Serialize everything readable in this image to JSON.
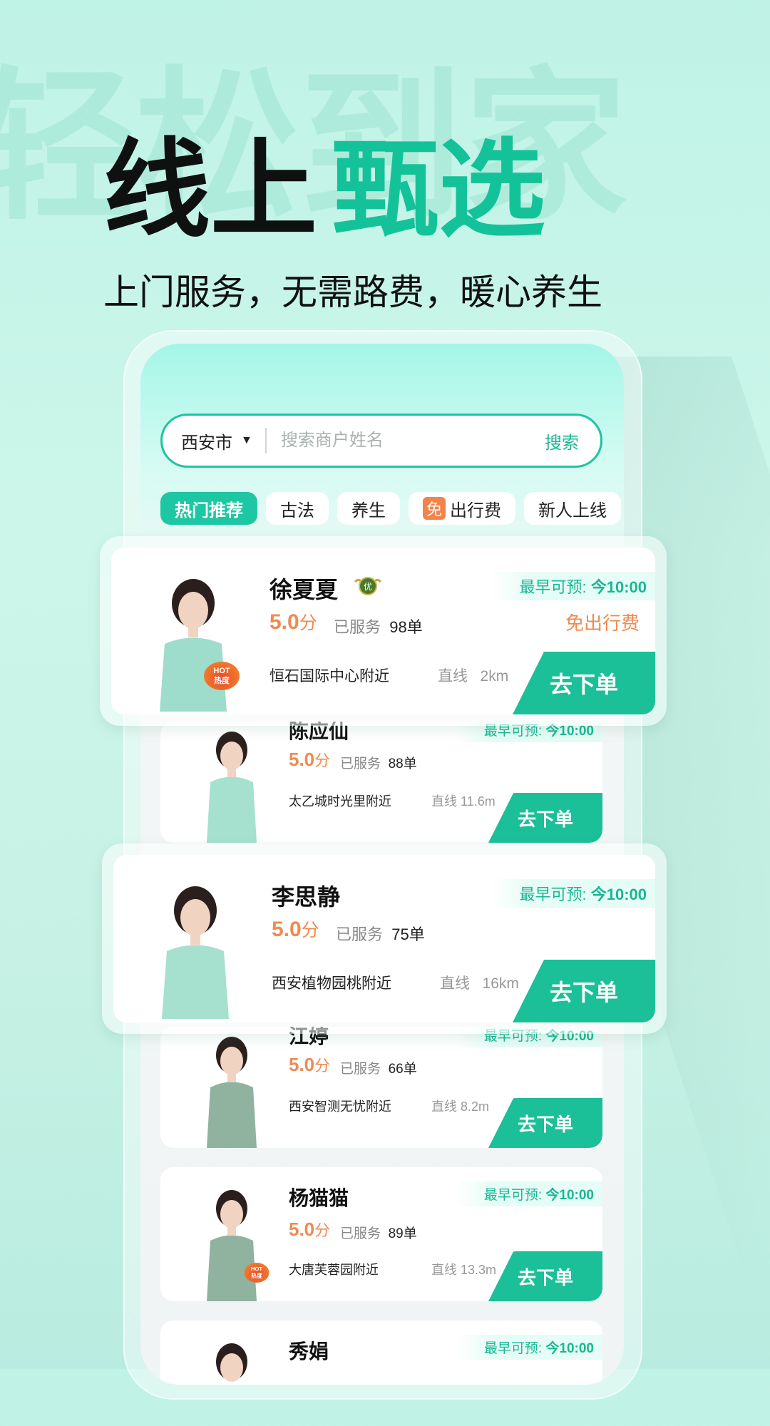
{
  "background_text": "轻松到家",
  "headline": {
    "part1": "线上",
    "part2": "甄选"
  },
  "subtitle": "上门服务，无需路费，暖心养生",
  "search": {
    "city": "西安市",
    "placeholder": "搜索商户姓名",
    "button": "搜索"
  },
  "tags": [
    {
      "label": "热门推荐",
      "active": true
    },
    {
      "label": "古法"
    },
    {
      "label": "养生"
    },
    {
      "badge": "免",
      "label": "出行费"
    },
    {
      "label": "新人上线"
    }
  ],
  "common": {
    "earliest_label": "最早可预: ",
    "earliest_time": "今10:00",
    "score_unit": "分",
    "served_label": "已服务",
    "distance_label": "直线",
    "order_button": "去下单",
    "hot_badge_top": "HOT",
    "hot_badge_bottom": "热度",
    "medal": "优"
  },
  "providers": [
    {
      "name": "徐夏夏",
      "score": "5.0",
      "orders": "98单",
      "address": "恒石国际中心附近",
      "distance": "2km",
      "free_fee": "免出行费",
      "hot": true,
      "medal": true,
      "uniform": "#9edccb"
    },
    {
      "name": "陈应仙",
      "score": "5.0",
      "orders": "88单",
      "address": "太乙城时光里附近",
      "distance": "11.6m",
      "uniform": "#a6e0cf"
    },
    {
      "name": "李思静",
      "score": "5.0",
      "orders": "75单",
      "address": "西安植物园桃附近",
      "distance": "16km",
      "uniform": "#a6e0cf"
    },
    {
      "name": "江婷",
      "score": "5.0",
      "orders": "66单",
      "address": "西安智测无忧附近",
      "distance": "8.2m",
      "uniform": "#8fb39f"
    },
    {
      "name": "杨猫猫",
      "score": "5.0",
      "orders": "89单",
      "address": "大唐芙蓉园附近",
      "distance": "13.3m",
      "hot": true,
      "uniform": "#8fb39f"
    },
    {
      "name": "秀娟",
      "uniform": "#8fb39f"
    }
  ]
}
